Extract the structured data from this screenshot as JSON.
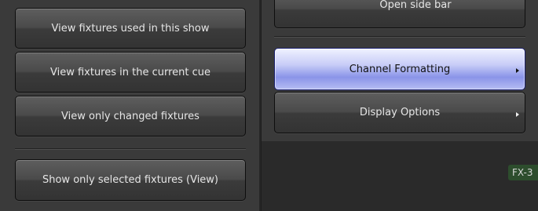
{
  "left_panel": {
    "buttons": [
      {
        "label": "View fixtures used in this show"
      },
      {
        "label": "View fixtures in the current cue"
      },
      {
        "label": "View only changed fixtures"
      },
      {
        "label": "Show only selected fixtures (View)"
      }
    ]
  },
  "right_panel": {
    "top_button": {
      "label": "Open side bar",
      "icon": "check-icon"
    },
    "buttons": [
      {
        "label": "Channel Formatting",
        "state": "active",
        "has_submenu": true
      },
      {
        "label": "Display Options",
        "state": "normal",
        "has_submenu": true
      }
    ]
  },
  "bottom_strip": {
    "badge": "FX-3"
  },
  "colors": {
    "active_accent": "#8a94e8",
    "check_green": "#3cbf2a"
  }
}
